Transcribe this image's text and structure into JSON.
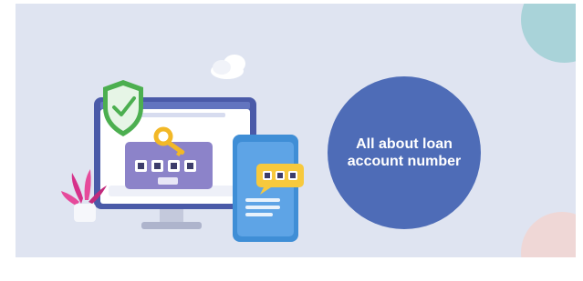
{
  "title": {
    "text": "All about loan account number"
  },
  "illustration": {
    "keypad_digits": [
      "*",
      "*",
      "*",
      "*"
    ],
    "phone_code": [
      "*",
      "*",
      "*"
    ]
  },
  "colors": {
    "background": "#dfe4f1",
    "circle": "#4e6cb7",
    "shield": "#4caf50",
    "key": "#f2b827",
    "monitor": "#4a5aa8",
    "panel": "#8c83c9",
    "phone": "#3f8ed6"
  }
}
